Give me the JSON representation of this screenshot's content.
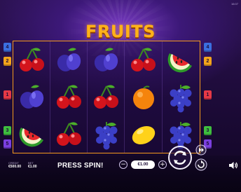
{
  "game": {
    "title": "FRUITS",
    "corner_text": "16:07"
  },
  "paylines": {
    "left": [
      {
        "label": "4",
        "color": "#3b6fe0",
        "row": 0
      },
      {
        "label": "2",
        "color": "#f3a51c",
        "row": 1
      },
      {
        "label": "1",
        "color": "#e63946",
        "row": 2
      },
      {
        "label": "3",
        "color": "#3fbf3f",
        "row": 3
      },
      {
        "label": "5",
        "color": "#7b3fe0",
        "row": 4
      }
    ],
    "right": [
      {
        "label": "4",
        "color": "#3b6fe0",
        "row": 0
      },
      {
        "label": "2",
        "color": "#f3a51c",
        "row": 1
      },
      {
        "label": "1",
        "color": "#e63946",
        "row": 2
      },
      {
        "label": "3",
        "color": "#3fbf3f",
        "row": 3
      },
      {
        "label": "5",
        "color": "#7b3fe0",
        "row": 4
      }
    ]
  },
  "reels": [
    [
      "cherry-icon",
      "plum-icon",
      "watermelon-icon"
    ],
    [
      "plum-icon",
      "cherry-icon",
      "cherry-icon"
    ],
    [
      "plum-icon",
      "cherry-icon",
      "grapes-icon"
    ],
    [
      "cherry-icon",
      "orange-icon",
      "lemon-icon"
    ],
    [
      "watermelon-icon",
      "grapes-icon",
      "grapes-icon"
    ]
  ],
  "footer": {
    "credit_label": "CREDIT",
    "credit_value": "€500.00",
    "bet_label": "BET",
    "bet_value": "€1.00",
    "status_text": "PRESS SPIN!",
    "bet_amount": "€1.00",
    "minus_label": "−",
    "plus_label": "+"
  },
  "colors": {
    "accent": "#f59a1c",
    "background": "#1b0a35"
  }
}
